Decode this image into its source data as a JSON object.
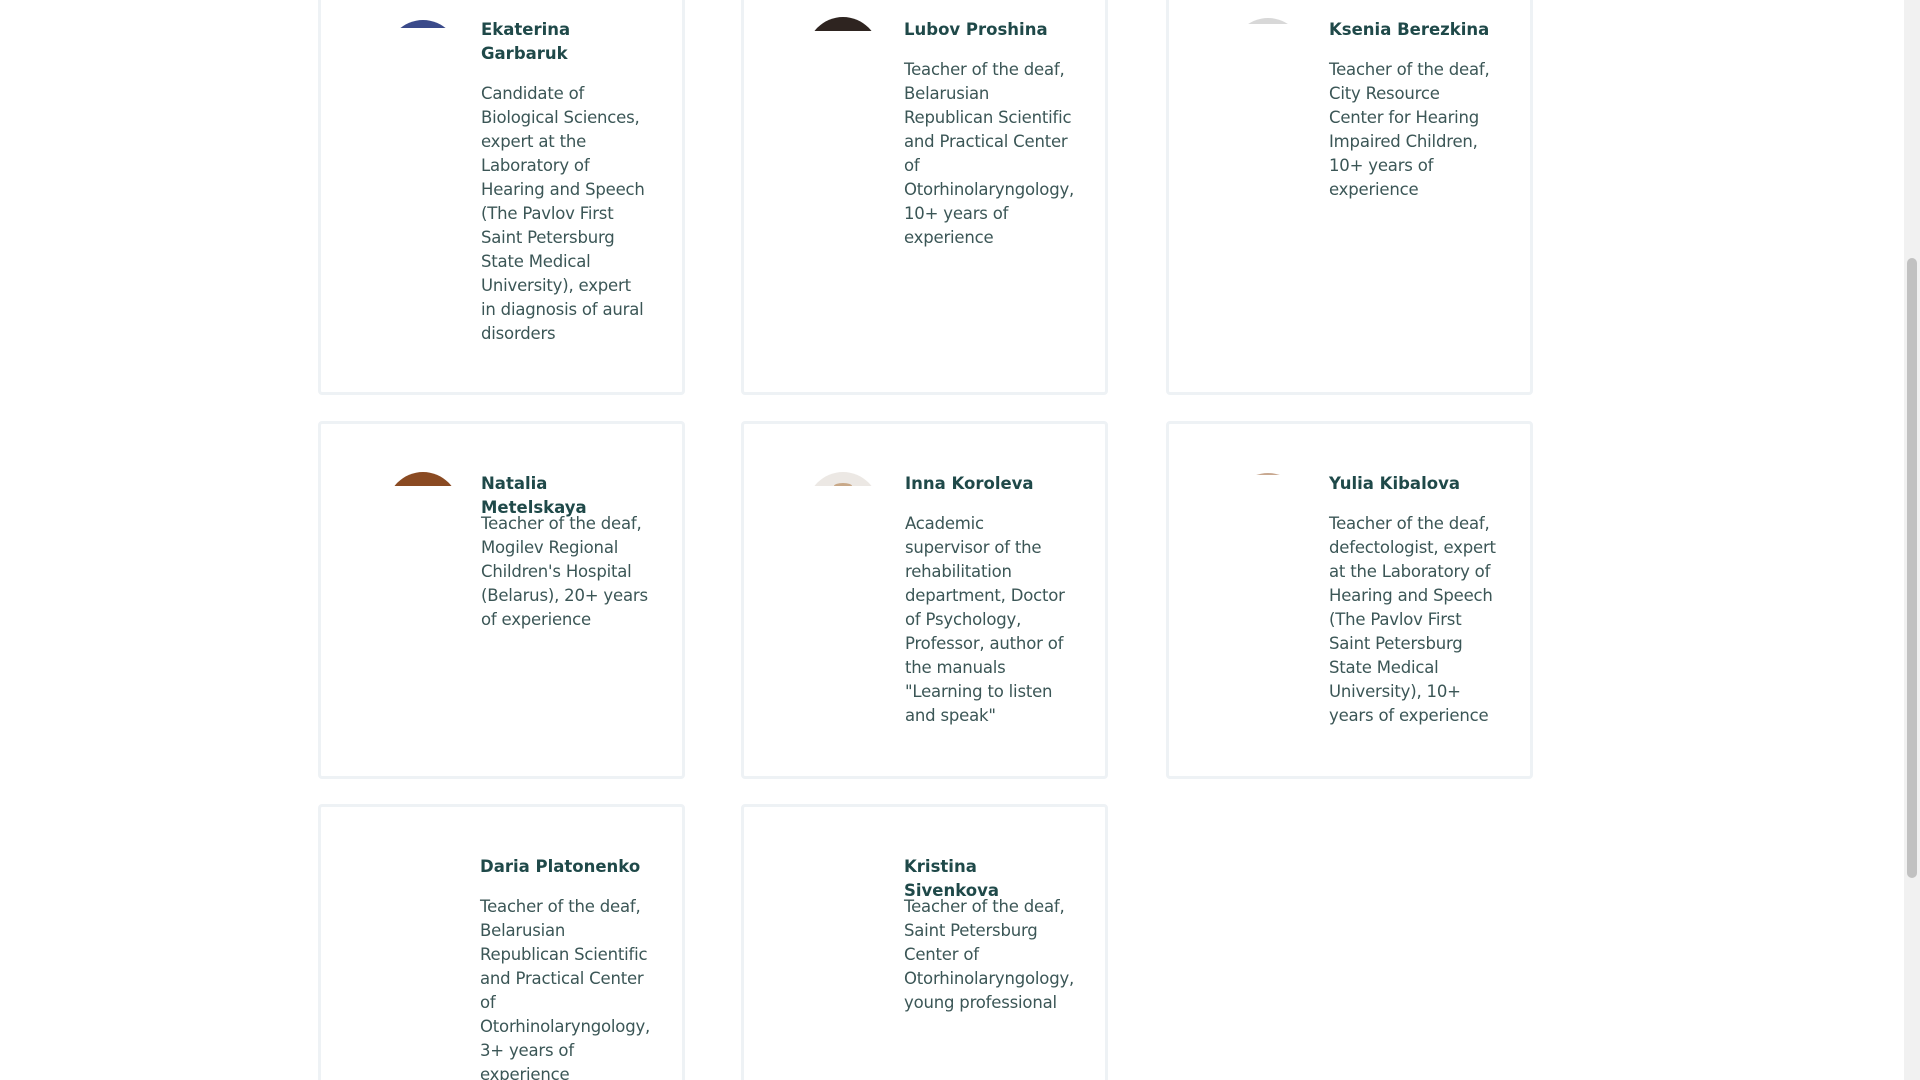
{
  "experts": [
    {
      "name": "Ekaterina Garbaruk",
      "description": "Candidate of Biological Sciences, expert at the Laboratory of Hearing and Speech (The Pavlov First Saint Petersburg State Medical University), expert in diagnosis of aural disorders",
      "avatar_color": "#3a4a8a"
    },
    {
      "name": "Lubov Proshina",
      "description": "Teacher of the deaf, Belarusian Republican Scientific and Practical Center of Otorhinolaryngology, 10+ years of experience",
      "avatar_color": "#2e2420"
    },
    {
      "name": "Ksenia Berezkina",
      "description": "Teacher of the deaf, City Resource Center for Hearing Impaired Children, 10+ years of experience",
      "avatar_color": "#d8d8d8"
    },
    {
      "name": "Natalia Metelskaya",
      "description": "Teacher of the deaf, Mogilev Regional Children's Hospital (Belarus), 20+ years of experience",
      "avatar_color": "#8a4a22"
    },
    {
      "name": "Inna Koroleva",
      "description": "Academic supervisor of the rehabilitation department, Doctor of Psychology, Professor, author of the manuals \"Learning to listen and speak\"",
      "avatar_color": "#ece8e4"
    },
    {
      "name": "Yulia Kibalova",
      "description": "Teacher of the deaf, defectologist, expert at the Laboratory of Hearing and Speech (The Pavlov First Saint Petersburg State Medical University), 10+ years of experience",
      "avatar_color": "#c8a890"
    },
    {
      "name": "Daria Platonenko",
      "description": "Teacher of the deaf, Belarusian Republican Scientific and Practical Center of Otorhinolaryngology, 3+ years of experience",
      "avatar_color": "#ffffff"
    },
    {
      "name": "Kristina Sivenkova",
      "description": "Teacher of the deaf, Saint Petersburg Center of Otorhinolaryngology, young professional",
      "avatar_color": "#ffffff"
    }
  ]
}
